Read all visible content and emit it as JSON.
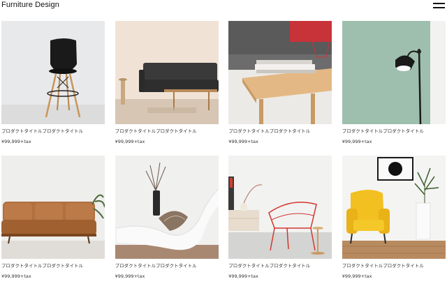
{
  "site": {
    "title": "Furniture Design",
    "menu_icon": "hamburger-menu-icon"
  },
  "products": [
    {
      "title": "プロダクトタイトルプロダクトタイトル",
      "price": "¥99,999+tax",
      "image": "black-bar-stool"
    },
    {
      "title": "プロダクトタイトルプロダクトタイトル",
      "price": "¥99,999+tax",
      "image": "dark-sofa-living-room"
    },
    {
      "title": "プロダクトタイトルプロダクトタイトル",
      "price": "¥99,999+tax",
      "image": "wooden-coffee-table"
    },
    {
      "title": "プロダクトタイトルプロダクトタイトル",
      "price": "¥99,999+tax",
      "image": "black-floor-lamp"
    },
    {
      "title": "プロダクトタイトルプロダクトタイトル",
      "price": "¥99,999+tax",
      "image": "tan-leather-sofa"
    },
    {
      "title": "プロダクトタイトルプロダクトタイトル",
      "price": "¥99,999+tax",
      "image": "white-lounge-chair"
    },
    {
      "title": "プロダクトタイトルプロダクトタイトル",
      "price": "¥99,999+tax",
      "image": "red-wire-chair"
    },
    {
      "title": "プロダクトタイトルプロダクトタイトル",
      "price": "¥99,999+tax",
      "image": "yellow-armchair"
    }
  ]
}
